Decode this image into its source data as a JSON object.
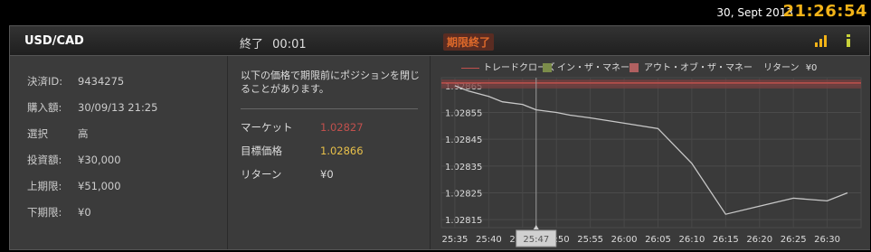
{
  "topbar": {
    "date": "30, Sept 2013",
    "time": "21:26:54"
  },
  "header": {
    "pair": "USD/CAD",
    "status_label": "終了",
    "status_time": "00:01",
    "expired_badge": "期限終了"
  },
  "details": [
    {
      "label": "決済ID:",
      "value": "9434275"
    },
    {
      "label": "購入額:",
      "value": "30/09/13 21:25"
    },
    {
      "label": "選択",
      "value": "高"
    },
    {
      "label": "投資額:",
      "value": "¥30,000"
    },
    {
      "label": "上期限:",
      "value": "¥51,000"
    },
    {
      "label": "下期限:",
      "value": "¥0"
    }
  ],
  "result": {
    "note": "以下の価格で期限前にポジションを閉じることがあります。",
    "market_label": "マーケット",
    "market_value": "1.02827",
    "target_label": "目標価格",
    "target_value": "1.02866",
    "return_label": "リターン",
    "return_value": "¥0"
  },
  "colors": {
    "accent": "#f2b318",
    "market": "#c0504d",
    "target": "#e8c04a",
    "in_money": "#7b8c4a",
    "out_money": "#b06060"
  },
  "legend": {
    "trade_close": "トレードクローズ",
    "in_the_money": "イン・ザ・マネー",
    "out_of_money": "アウト・オブ・ザ・マネー",
    "return_label": "リターン",
    "return_value": "¥0"
  },
  "icons": [
    "bar-chart-icon",
    "info-icon"
  ],
  "chart_data": {
    "type": "line",
    "x": [
      "25:35",
      "25:37",
      "25:40",
      "25:42",
      "25:45",
      "25:47",
      "25:50",
      "25:52",
      "25:55",
      "26:00",
      "26:05",
      "26:10",
      "26:15",
      "26:20",
      "26:25",
      "26:30",
      "26:33"
    ],
    "y": [
      1.02865,
      1.02863,
      1.02861,
      1.02859,
      1.02858,
      1.02856,
      1.02855,
      1.02854,
      1.02853,
      1.02851,
      1.02849,
      1.02836,
      1.02817,
      1.0282,
      1.02823,
      1.02822,
      1.02825
    ],
    "x_ticks": [
      "25:35",
      "25:40",
      "25:45",
      "25:50",
      "25:55",
      "26:00",
      "26:05",
      "26:10",
      "26:15",
      "26:20",
      "26:25",
      "26:30"
    ],
    "y_ticks": [
      "1.02865",
      "1.02855",
      "1.02845",
      "1.02835",
      "1.02825",
      "1.02815"
    ],
    "ylim": [
      1.02812,
      1.02868
    ],
    "target_price": 1.02866,
    "marker_label": "25:47",
    "grid": true
  }
}
